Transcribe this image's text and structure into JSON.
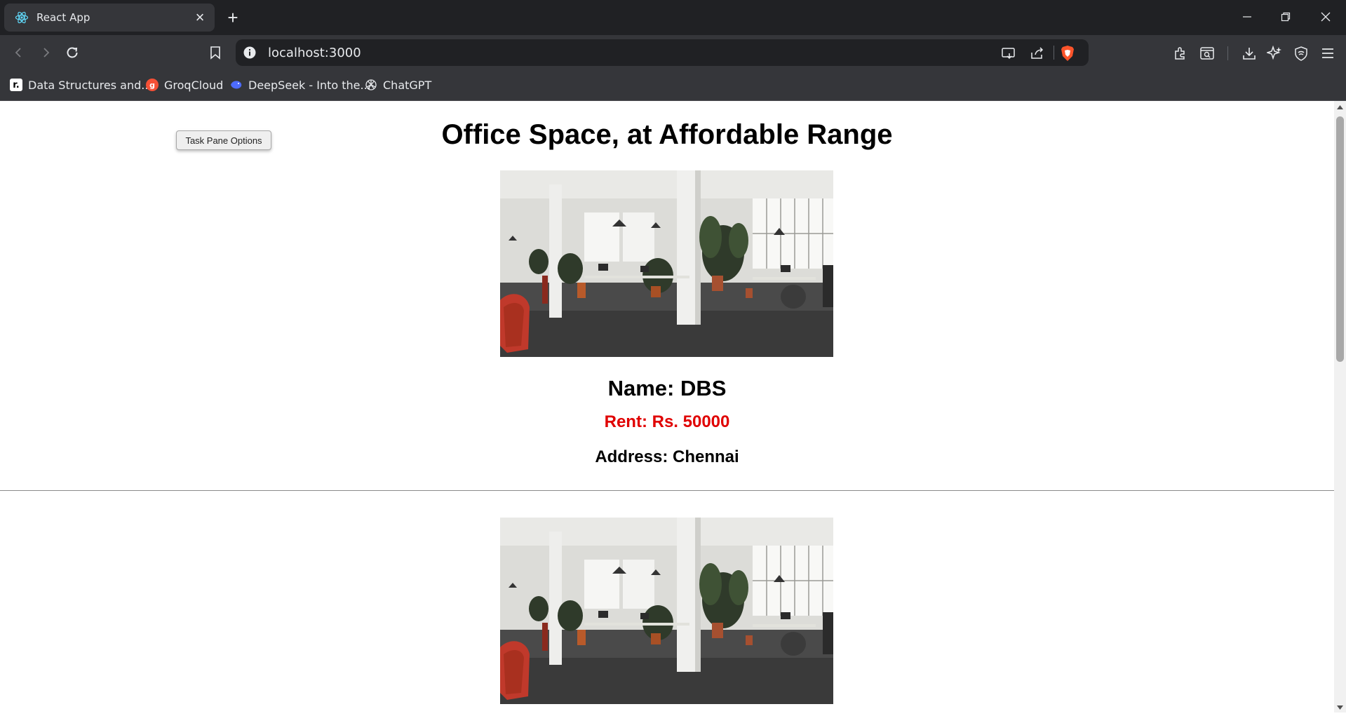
{
  "browser": {
    "tab": {
      "title": "React App",
      "favicon": "react-icon"
    },
    "url": "localhost:3000",
    "bookmarks": [
      {
        "label": "Data Structures and...",
        "icon": "r-logo-icon"
      },
      {
        "label": "GroqCloud",
        "icon": "groq-icon"
      },
      {
        "label": "DeepSeek - Into the...",
        "icon": "deepseek-icon"
      },
      {
        "label": "ChatGPT",
        "icon": "chatgpt-icon"
      }
    ]
  },
  "page": {
    "task_pane_button": "Task Pane Options",
    "heading": "Office Space, at Affordable Range",
    "offices": [
      {
        "name": "Name: DBS",
        "rent": "Rent: Rs. 50000",
        "rent_color": "#e00000",
        "address": "Address: Chennai"
      },
      {
        "name": "",
        "rent": "",
        "address": ""
      }
    ]
  }
}
